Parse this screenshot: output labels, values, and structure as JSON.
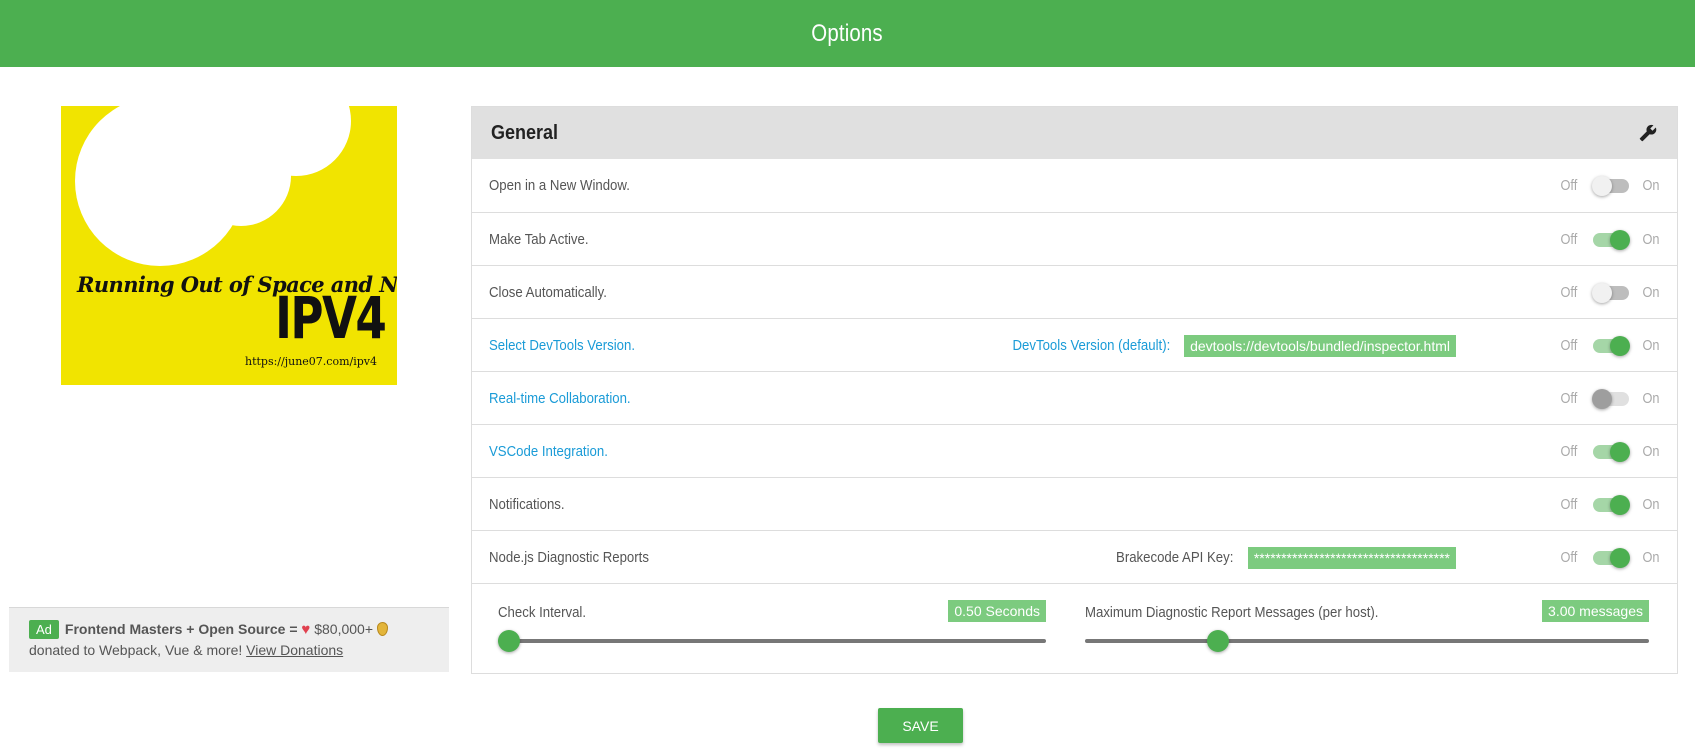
{
  "header": {
    "title": "Options"
  },
  "ad_image": {
    "line1": "Running Out of Space and Need",
    "line2": "IPV4",
    "url": "https://june07.com/ipv4"
  },
  "ad_banner": {
    "tag": "Ad",
    "strong": "Frontend Masters + Open Source =",
    "amount": "$80,000+",
    "rest": "donated to Webpack, Vue & more!",
    "link": "View Donations"
  },
  "panel": {
    "title": "General",
    "icon": "wrench-icon",
    "off_label": "Off",
    "on_label": "On",
    "rows": [
      {
        "label": "Open in a New Window.",
        "state": "off"
      },
      {
        "label": "Make Tab Active.",
        "state": "on"
      },
      {
        "label": "Close Automatically.",
        "state": "off"
      },
      {
        "label": "Select DevTools Version.",
        "state": "on",
        "field_label": "DevTools Version (default):",
        "field_value": "devtools://devtools/bundled/inspector.html"
      },
      {
        "label": "Real-time Collaboration.",
        "state": "off"
      },
      {
        "label": "VSCode Integration.",
        "state": "on"
      },
      {
        "label": "Notifications.",
        "state": "on"
      },
      {
        "label": "Node.js Diagnostic Reports",
        "state": "on",
        "field_label": "Brakecode API Key:",
        "field_value": "************************************"
      }
    ],
    "sliders": [
      {
        "label": "Check Interval.",
        "value": "0.50 Seconds",
        "fraction": 0.0
      },
      {
        "label": "Maximum Diagnostic Report Messages (per host).",
        "value": "3.00 messages",
        "fraction": 0.235
      }
    ]
  },
  "save_label": "SAVE",
  "colors": {
    "accent": "#4caf50",
    "link": "#1a9bd7",
    "ad_yellow": "#f1e400"
  }
}
